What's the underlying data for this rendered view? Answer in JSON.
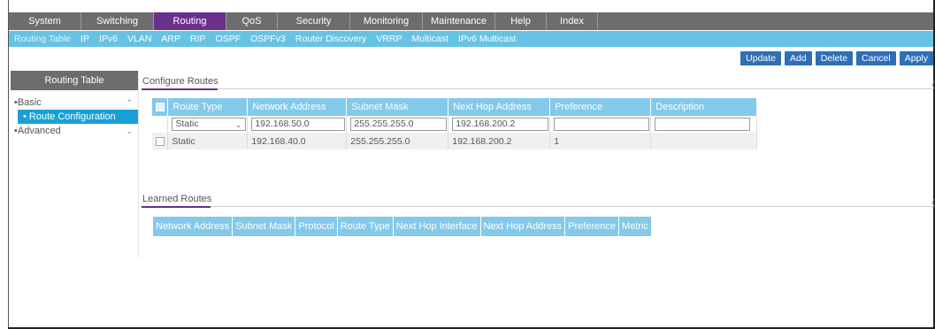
{
  "top_nav": [
    "System",
    "Switching",
    "Routing",
    "QoS",
    "Security",
    "Monitoring",
    "Maintenance",
    "Help",
    "Index"
  ],
  "sub_nav": [
    "Routing Table",
    "IP",
    "IPv6",
    "VLAN",
    "ARP",
    "RIP",
    "OSPF",
    "OSPFv3",
    "Router Discovery",
    "VRRP",
    "Multicast",
    "IPv6 Multicast"
  ],
  "buttons": {
    "update": "Update",
    "add": "Add",
    "delete": "Delete",
    "cancel": "Cancel",
    "apply": "Apply"
  },
  "sidebar": {
    "title": "Routing Table",
    "basic": "Basic",
    "route_configuration": "Route Configuration",
    "advanced": "Advanced"
  },
  "configure_routes": {
    "title": "Configure Routes",
    "headers": [
      "Route Type",
      "Network Address",
      "Subnet Mask",
      "Next Hop Address",
      "Preference",
      "Description"
    ],
    "edit_row": {
      "route_type": "Static",
      "network_address": "192.168.50.0",
      "subnet_mask": "255.255.255.0",
      "next_hop": "192.168.200.2",
      "preference": "",
      "description": ""
    },
    "rows": [
      {
        "route_type": "Static",
        "network_address": "192.168.40.0",
        "subnet_mask": "255.255.255.0",
        "next_hop": "192.168.200.2",
        "preference": "1",
        "description": ""
      }
    ]
  },
  "learned_routes": {
    "title": "Learned Routes",
    "headers": [
      "Network Address",
      "Subnet Mask",
      "Protocol",
      "Route Type",
      "Next Hop Interface",
      "Next Hop Address",
      "Preference",
      "Metric"
    ]
  }
}
